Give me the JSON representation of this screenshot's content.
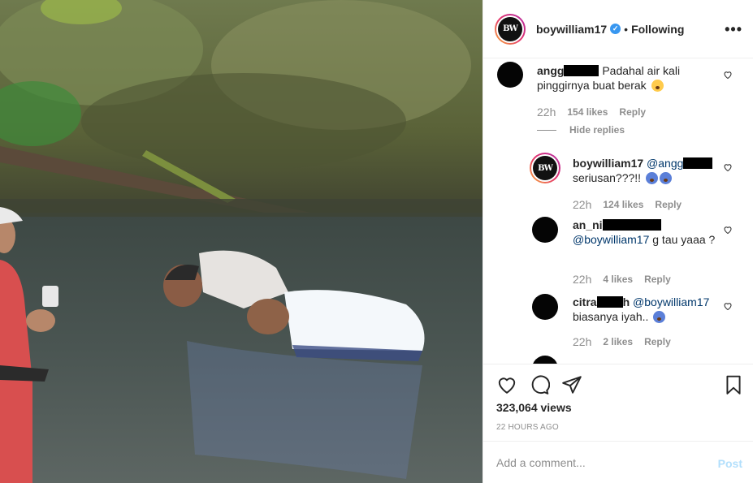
{
  "header": {
    "username": "boywilliam17",
    "separator": "•",
    "follow_status": "Following",
    "more_icon": "more-horizontal-icon",
    "avatar_monogram": "BW"
  },
  "comments": [
    {
      "username": "angg",
      "text": "Padahal air kali pinggirnya buat berak",
      "emoji": "crying-face",
      "time": "22h",
      "likes": "154 likes",
      "reply": "Reply",
      "hide_replies": "Hide replies"
    },
    {
      "username": "boywilliam17",
      "mention": "@angg",
      "text": "seriusan???!!",
      "emoji": "screaming-face",
      "time": "22h",
      "likes": "124 likes",
      "reply": "Reply"
    },
    {
      "username": "an_ni",
      "mention": "@boywilliam17",
      "text": "g tau yaaa ?",
      "time": "22h",
      "likes": "4 likes",
      "reply": "Reply"
    },
    {
      "username": "citra",
      "suffix": "h",
      "mention": "@boywilliam17",
      "text": "biasanya iyah..",
      "emoji": "screaming-face",
      "time": "22h",
      "likes": "2 likes",
      "reply": "Reply"
    }
  ],
  "actions": {
    "like_icon": "heart-icon",
    "comment_icon": "comment-icon",
    "share_icon": "paper-plane-icon",
    "save_icon": "bookmark-icon",
    "views": "323,064 views",
    "posted": "22 HOURS AGO"
  },
  "add_comment": {
    "placeholder": "Add a comment...",
    "post_label": "Post"
  },
  "colors": {
    "link": "#00376b",
    "muted": "#8e8e8e",
    "verified": "#3897f0",
    "post_disabled": "#b2dffc"
  }
}
